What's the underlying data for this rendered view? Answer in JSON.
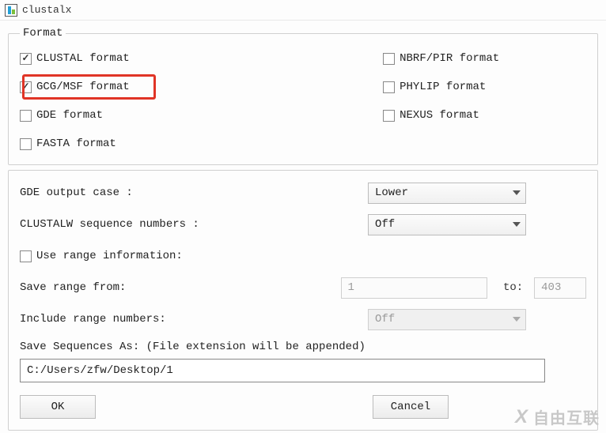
{
  "window": {
    "title": "clustalx"
  },
  "format": {
    "legend": "Format",
    "clustal": {
      "label": "CLUSTAL format",
      "checked": true
    },
    "gcgmsf": {
      "label": "GCG/MSF format",
      "checked": true
    },
    "gde": {
      "label": "GDE format",
      "checked": false
    },
    "fasta": {
      "label": "FASTA format",
      "checked": false
    },
    "nbrf": {
      "label": "NBRF/PIR format",
      "checked": false
    },
    "phylip": {
      "label": "PHYLIP format",
      "checked": false
    },
    "nexus": {
      "label": "NEXUS format",
      "checked": false
    }
  },
  "options": {
    "gde_case_label": "GDE output case :",
    "gde_case_value": "Lower",
    "clustalw_seq_label": "CLUSTALW sequence numbers :",
    "clustalw_seq_value": "Off",
    "use_range": {
      "label": "Use range information:",
      "checked": false
    },
    "range_from_label": "Save range from:",
    "range_from_value": "1",
    "range_to_label": "to:",
    "range_to_value": "403",
    "include_range_label": "Include range numbers:",
    "include_range_value": "Off",
    "save_as_label": "Save Sequences As: (File extension will be appended)",
    "save_as_value": "C:/Users/zfw/Desktop/1"
  },
  "buttons": {
    "ok": "OK",
    "cancel": "Cancel"
  },
  "watermark": {
    "x": "X",
    "text": "自由互联"
  }
}
